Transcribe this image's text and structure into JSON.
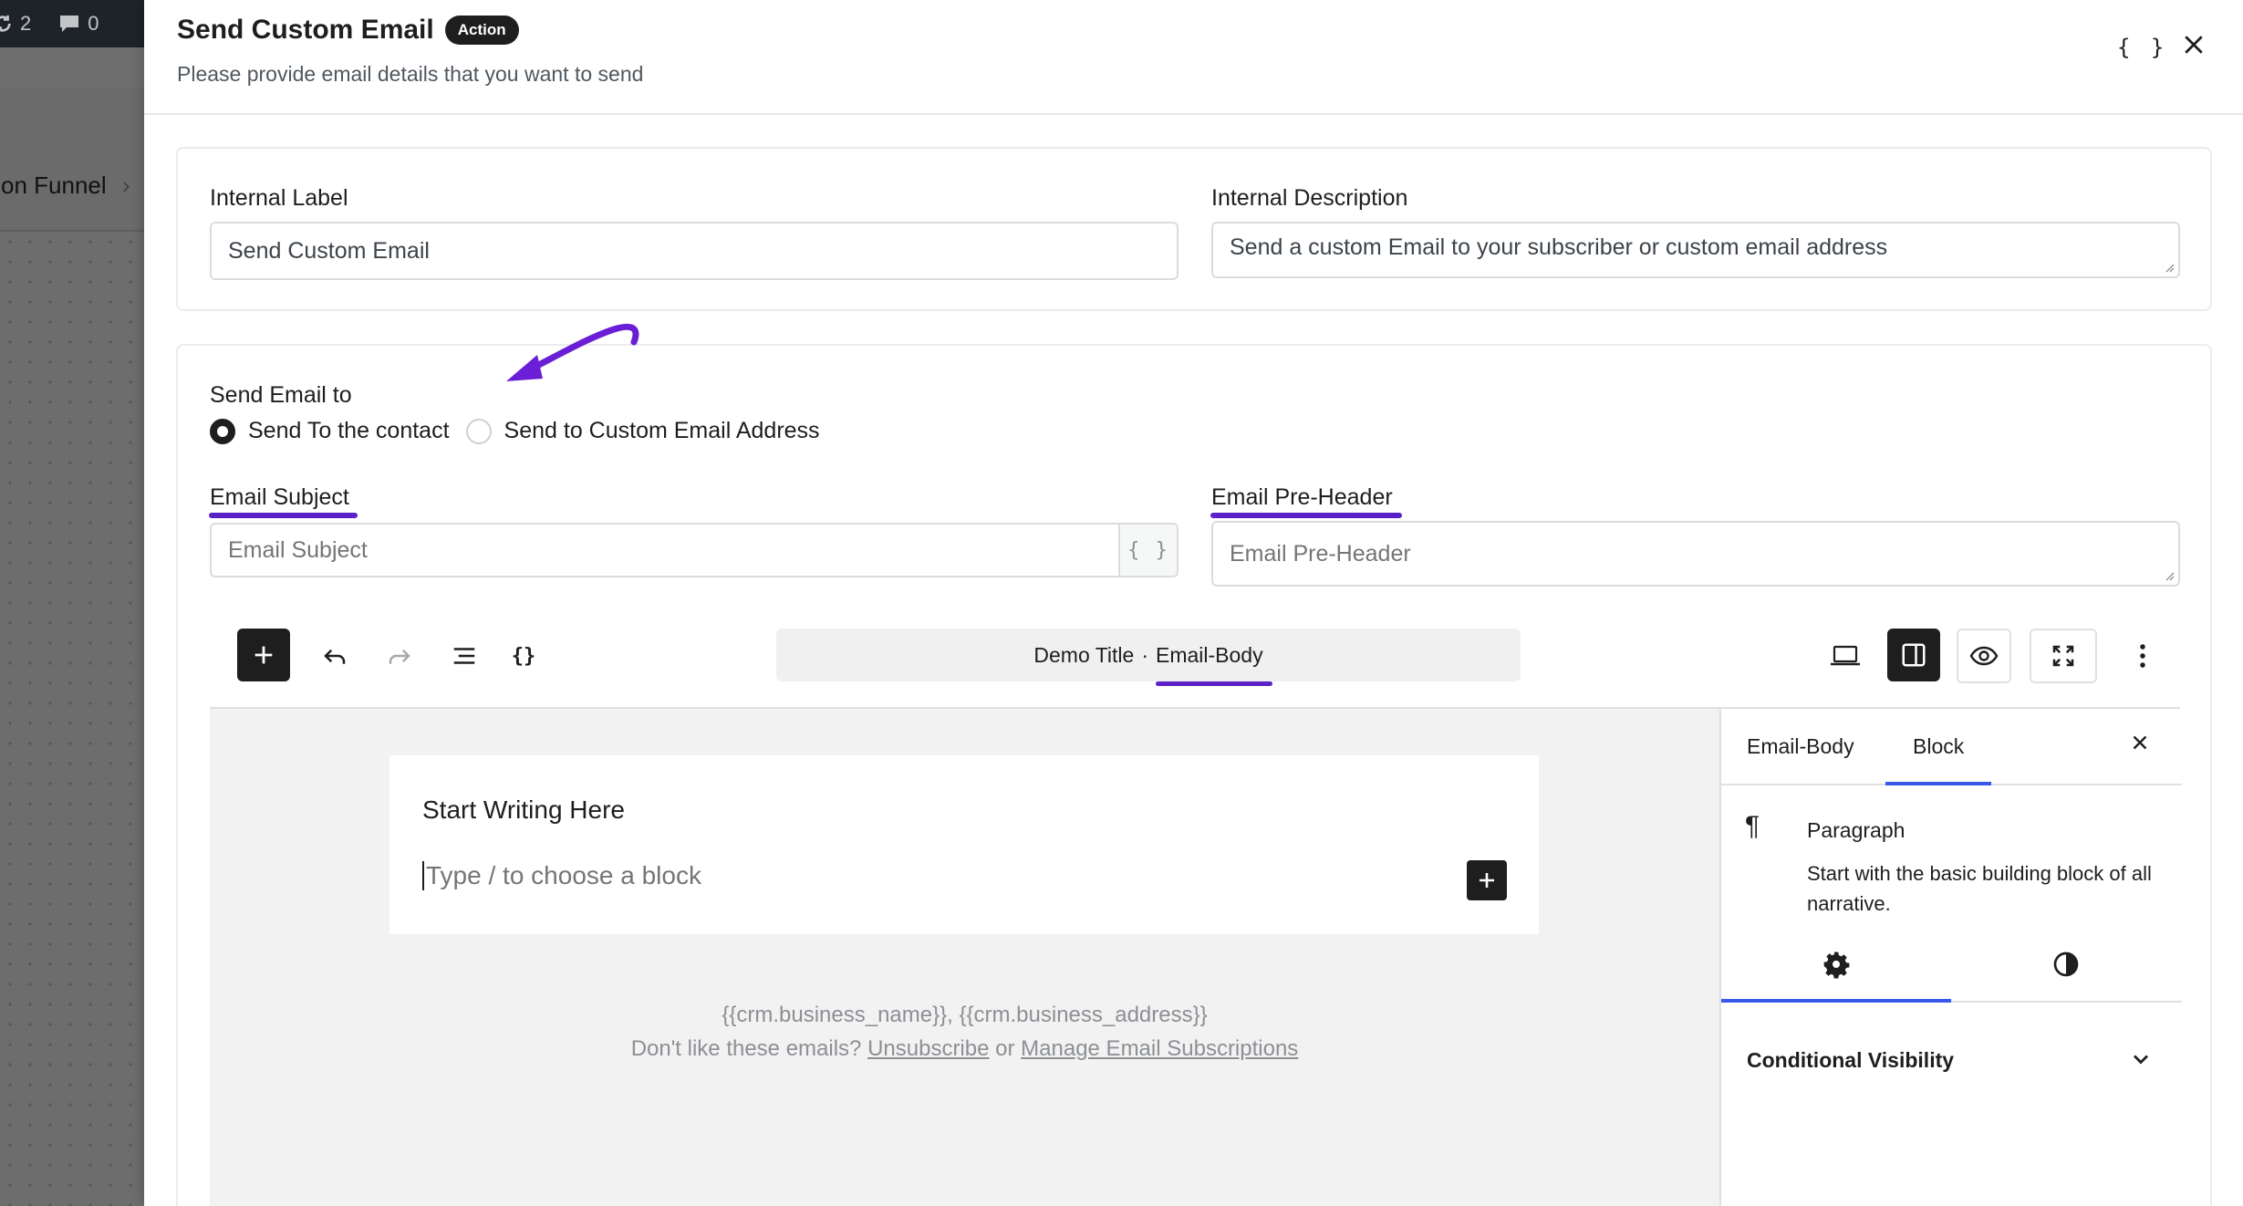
{
  "background": {
    "admin_bar": {
      "updates_count": "2",
      "comments_count": "0"
    },
    "breadcrumb_text": "tion Funnel"
  },
  "drawer": {
    "title": "Send Custom Email",
    "badge": "Action",
    "subtitle": "Please provide email details that you want to send",
    "code_icon": "{ }"
  },
  "form": {
    "internal_label": {
      "label": "Internal Label",
      "value": "Send Custom Email"
    },
    "internal_description": {
      "label": "Internal Description",
      "value": "Send a custom Email to your subscriber or custom email address"
    },
    "send_email_to": {
      "label": "Send Email to",
      "options": [
        {
          "label": "Send To the contact",
          "checked": true
        },
        {
          "label": "Send to Custom Email Address",
          "checked": false
        }
      ]
    },
    "email_subject": {
      "label": "Email Subject",
      "placeholder": "Email Subject",
      "smartcode": "{ }"
    },
    "email_preheader": {
      "label": "Email Pre-Header",
      "placeholder": "Email Pre-Header"
    }
  },
  "editor": {
    "doc_title": "Demo Title",
    "doc_separator": "·",
    "doc_type": "Email-Body",
    "block_heading": "Start Writing Here",
    "block_placeholder": "Type / to choose a block",
    "footer": {
      "line1": "{{crm.business_name}}, {{crm.business_address}}",
      "prefix": "Don't like these emails?",
      "unsubscribe": "Unsubscribe",
      "or": "or",
      "manage": "Manage Email Subscriptions"
    }
  },
  "panel": {
    "tabs": [
      "Email-Body",
      "Block"
    ],
    "active_tab": "Block",
    "block_name": "Paragraph",
    "block_desc": "Start with the basic building block of all narrative.",
    "conditional_visibility": "Conditional Visibility"
  },
  "colors": {
    "accent_underline": "#5b21c9",
    "active_tab": "#3858e9",
    "arrow": "#6a1fd6"
  },
  "icons": [
    "sync-icon",
    "comment-icon",
    "code-braces-icon",
    "close-icon",
    "plus-icon",
    "undo-icon",
    "redo-icon",
    "list-view-icon",
    "desktop-icon",
    "sidebar-icon",
    "eye-icon",
    "fullscreen-icon",
    "more-vertical-icon",
    "paragraph-icon",
    "gear-icon",
    "contrast-icon",
    "chevron-down-icon"
  ]
}
